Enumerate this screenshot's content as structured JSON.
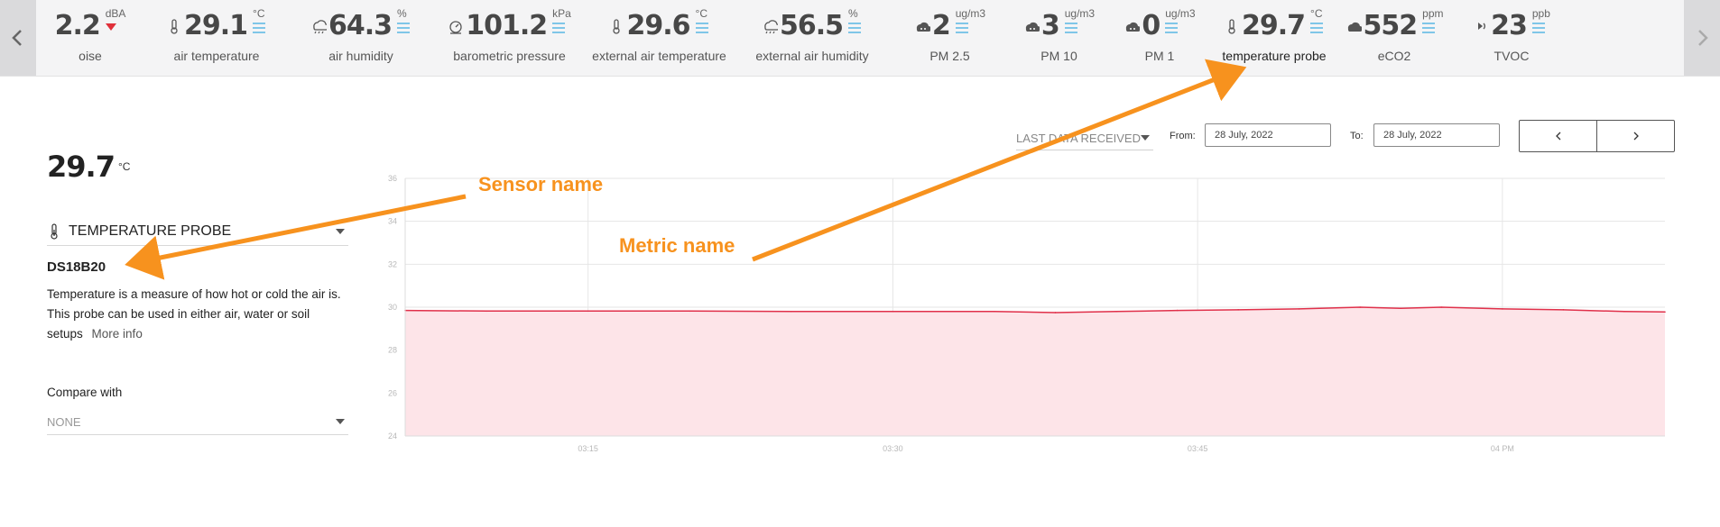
{
  "strip": {
    "metrics": [
      {
        "value": "2.2",
        "unit": "dBA",
        "label": "oise",
        "icon": "noise-icon",
        "indicator": "down-arrow",
        "active": false
      },
      {
        "value": "29.1",
        "unit": "°C",
        "label": "air temperature",
        "icon": "thermometer-icon",
        "indicator": "bars",
        "active": false
      },
      {
        "value": "64.3",
        "unit": "%",
        "label": "air humidity",
        "icon": "cloud-rain-icon",
        "indicator": "bars",
        "active": false
      },
      {
        "value": "101.2",
        "unit": "kPa",
        "label": "barometric pressure",
        "icon": "gauge-icon",
        "indicator": "bars",
        "active": false
      },
      {
        "value": "29.6",
        "unit": "°C",
        "label": "external air temperature",
        "icon": "thermometer-icon",
        "indicator": "bars",
        "active": false
      },
      {
        "value": "56.5",
        "unit": "%",
        "label": "external air humidity",
        "icon": "cloud-rain-icon",
        "indicator": "bars",
        "active": false
      },
      {
        "value": "2",
        "unit": "ug/m3",
        "label": "PM 2.5",
        "icon": "cloud-dust-icon",
        "indicator": "bars",
        "active": false
      },
      {
        "value": "3",
        "unit": "ug/m3",
        "label": "PM 10",
        "icon": "cloud-dust-icon",
        "indicator": "bars",
        "active": false
      },
      {
        "value": "0",
        "unit": "ug/m3",
        "label": "PM 1",
        "icon": "cloud-dust-icon",
        "indicator": "bars",
        "active": false
      },
      {
        "value": "29.7",
        "unit": "°C",
        "label": "temperature probe",
        "icon": "thermometer-icon",
        "indicator": "bars",
        "active": true
      },
      {
        "value": "552",
        "unit": "ppm",
        "label": "eCO2",
        "icon": "cloud-icon",
        "indicator": "bars",
        "active": false
      },
      {
        "value": "23",
        "unit": "ppb",
        "label": "TVOC",
        "icon": "voc-icon",
        "indicator": "bars",
        "active": false
      }
    ]
  },
  "panel": {
    "value": "29.7",
    "unit": "°C",
    "sensor_select": "TEMPERATURE PROBE",
    "sensor_name": "DS18B20",
    "description": "Temperature is a measure of how hot or cold the air is. This probe can be used in either air, water or soil setups",
    "more_info": "More info",
    "compare_label": "Compare with",
    "compare_value": "NONE"
  },
  "controls": {
    "range": "LAST DATA RECEIVED",
    "from_label": "From:",
    "from_value": "28 July, 2022",
    "to_label": "To:",
    "to_value": "28 July, 2022"
  },
  "annotations": {
    "sensor": "Sensor name",
    "metric": "Metric name",
    "color": "#f7921e"
  },
  "colors": {
    "accent_bars": "#7fc6e8",
    "line": "#e0304a",
    "area": "#fde4e8",
    "down_indicator": "#e0303a"
  },
  "chart_data": {
    "type": "area",
    "ylim": [
      24,
      36
    ],
    "yticks": [
      24,
      26,
      28,
      30,
      32,
      34,
      36
    ],
    "xlim": [
      "03:06",
      "04:08"
    ],
    "xticks": [
      "03:15",
      "03:30",
      "03:45",
      "04 PM"
    ],
    "grid": true,
    "series": [
      {
        "x": [
          "03:06",
          "03:10",
          "03:15",
          "03:20",
          "03:25",
          "03:30",
          "03:35",
          "03:38",
          "03:41",
          "03:44",
          "03:47",
          "03:50",
          "03:53",
          "03:55",
          "03:57",
          "04:00",
          "04:03",
          "04:06",
          "04:08"
        ],
        "values": [
          29.85,
          29.82,
          29.82,
          29.82,
          29.8,
          29.8,
          29.8,
          29.75,
          29.8,
          29.85,
          29.88,
          29.92,
          30.0,
          29.95,
          30.0,
          29.92,
          29.88,
          29.8,
          29.78
        ]
      }
    ]
  }
}
